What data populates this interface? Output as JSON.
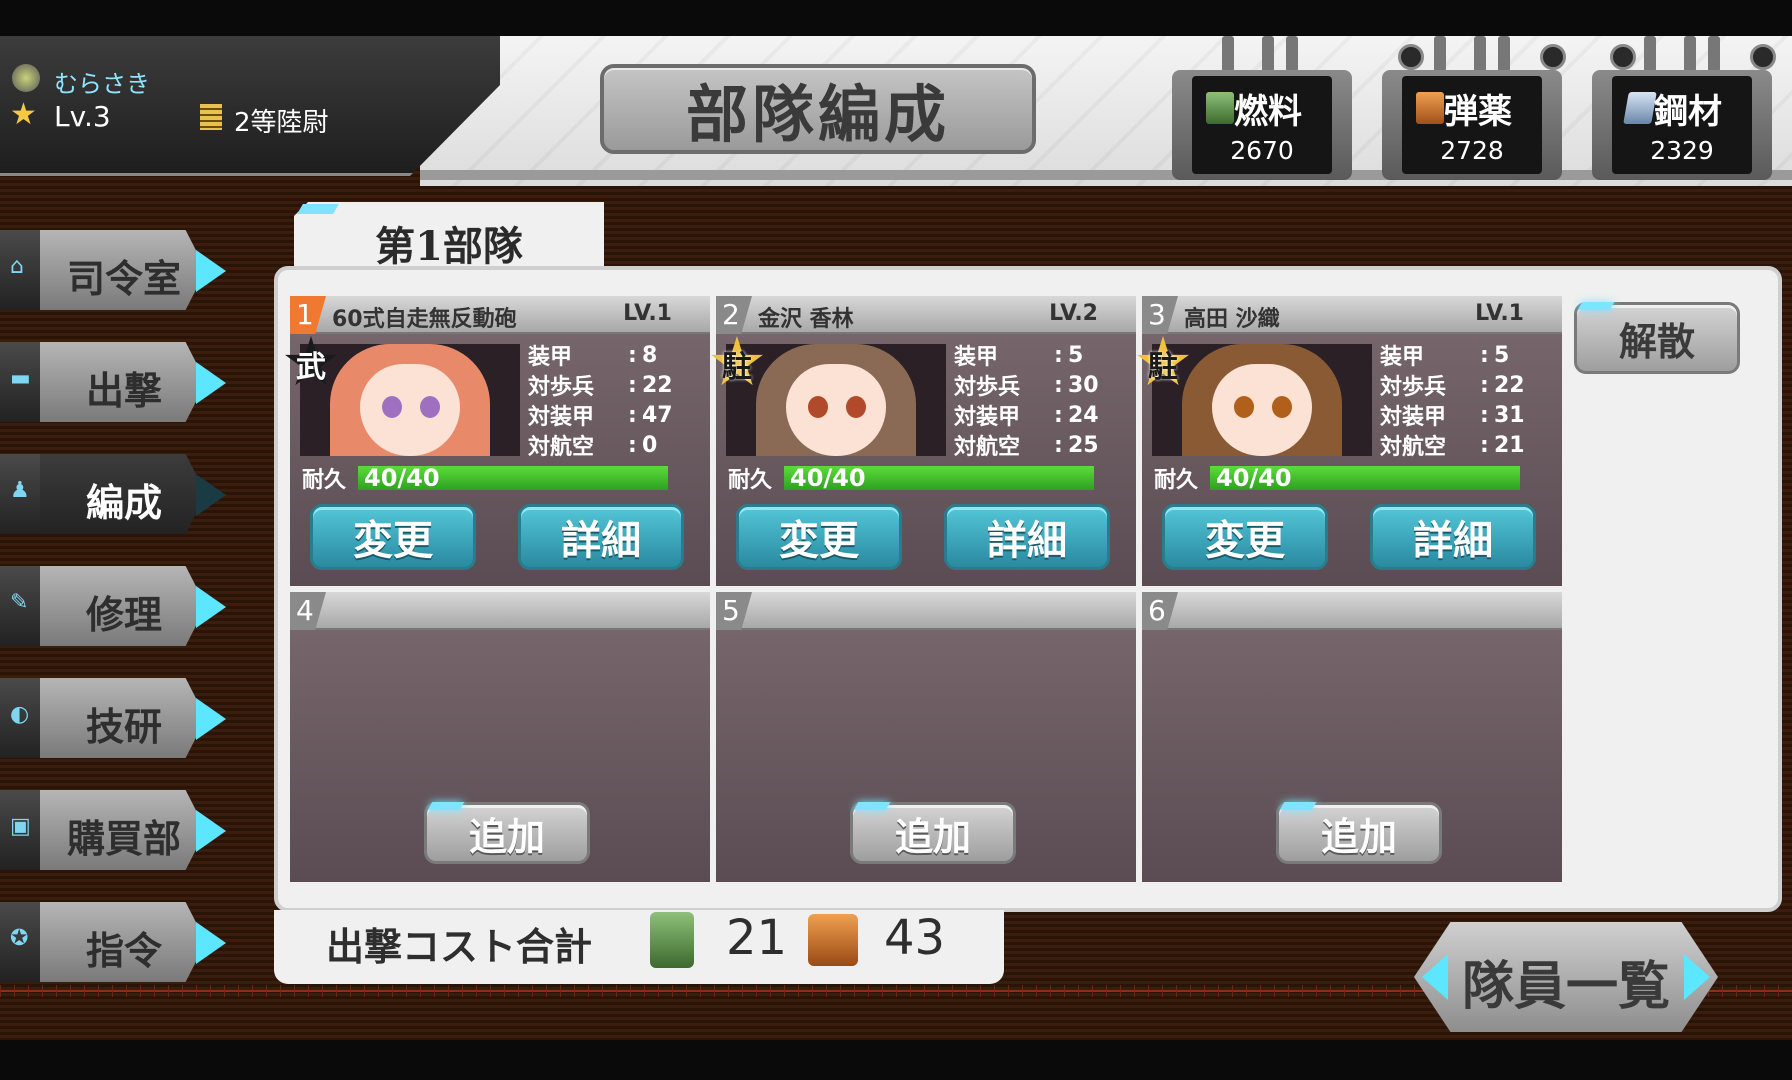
{
  "player": {
    "name": "むらさき",
    "level": "Lv.3",
    "rank": "2等陸尉"
  },
  "header": {
    "title": "部隊編成"
  },
  "resources": [
    {
      "label": "燃料",
      "value": "2670",
      "icon": "fuel-can-icon"
    },
    {
      "label": "弾薬",
      "value": "2728",
      "icon": "ammo-box-icon"
    },
    {
      "label": "鋼材",
      "value": "2329",
      "icon": "steel-ingot-icon"
    }
  ],
  "sidebar": {
    "items": [
      {
        "label": "司令室",
        "icon": "home-icon",
        "glyph": "⌂"
      },
      {
        "label": "出撃",
        "icon": "tank-icon",
        "glyph": "▬"
      },
      {
        "label": "編成",
        "icon": "people-icon",
        "glyph": "♟"
      },
      {
        "label": "修理",
        "icon": "wrench-icon",
        "glyph": "✎"
      },
      {
        "label": "技研",
        "icon": "flame-icon",
        "glyph": "◐"
      },
      {
        "label": "購買部",
        "icon": "shop-bag-icon",
        "glyph": "▣"
      },
      {
        "label": "指令",
        "icon": "star-badge-icon",
        "glyph": "✪"
      }
    ]
  },
  "squad": {
    "tab_label": "第1部隊",
    "disband_label": "解散",
    "change_label": "変更",
    "detail_label": "詳細",
    "add_label": "追加",
    "hp_label": "耐久",
    "stat_labels": [
      "装甲",
      "対歩兵",
      "対装甲",
      "対航空"
    ],
    "members": [
      {
        "slot": "1",
        "name": "60式自走無反動砲",
        "level": "LV.1",
        "badge": "武",
        "stats": [
          "8",
          "22",
          "47",
          "0"
        ],
        "hp": "40/40",
        "hp_ratio": 1.0
      },
      {
        "slot": "2",
        "name": "金沢 香林",
        "level": "LV.2",
        "badge": "駐",
        "stats": [
          "5",
          "30",
          "24",
          "25"
        ],
        "hp": "40/40",
        "hp_ratio": 1.0
      },
      {
        "slot": "3",
        "name": "高田 沙織",
        "level": "LV.1",
        "badge": "駐",
        "stats": [
          "5",
          "22",
          "31",
          "21"
        ],
        "hp": "40/40",
        "hp_ratio": 1.0
      }
    ],
    "empty_slots": [
      "4",
      "5",
      "6"
    ]
  },
  "cost": {
    "label": "出撃コスト合計",
    "fuel": "21",
    "ammo": "43"
  },
  "roster": {
    "label": "隊員一覧"
  }
}
